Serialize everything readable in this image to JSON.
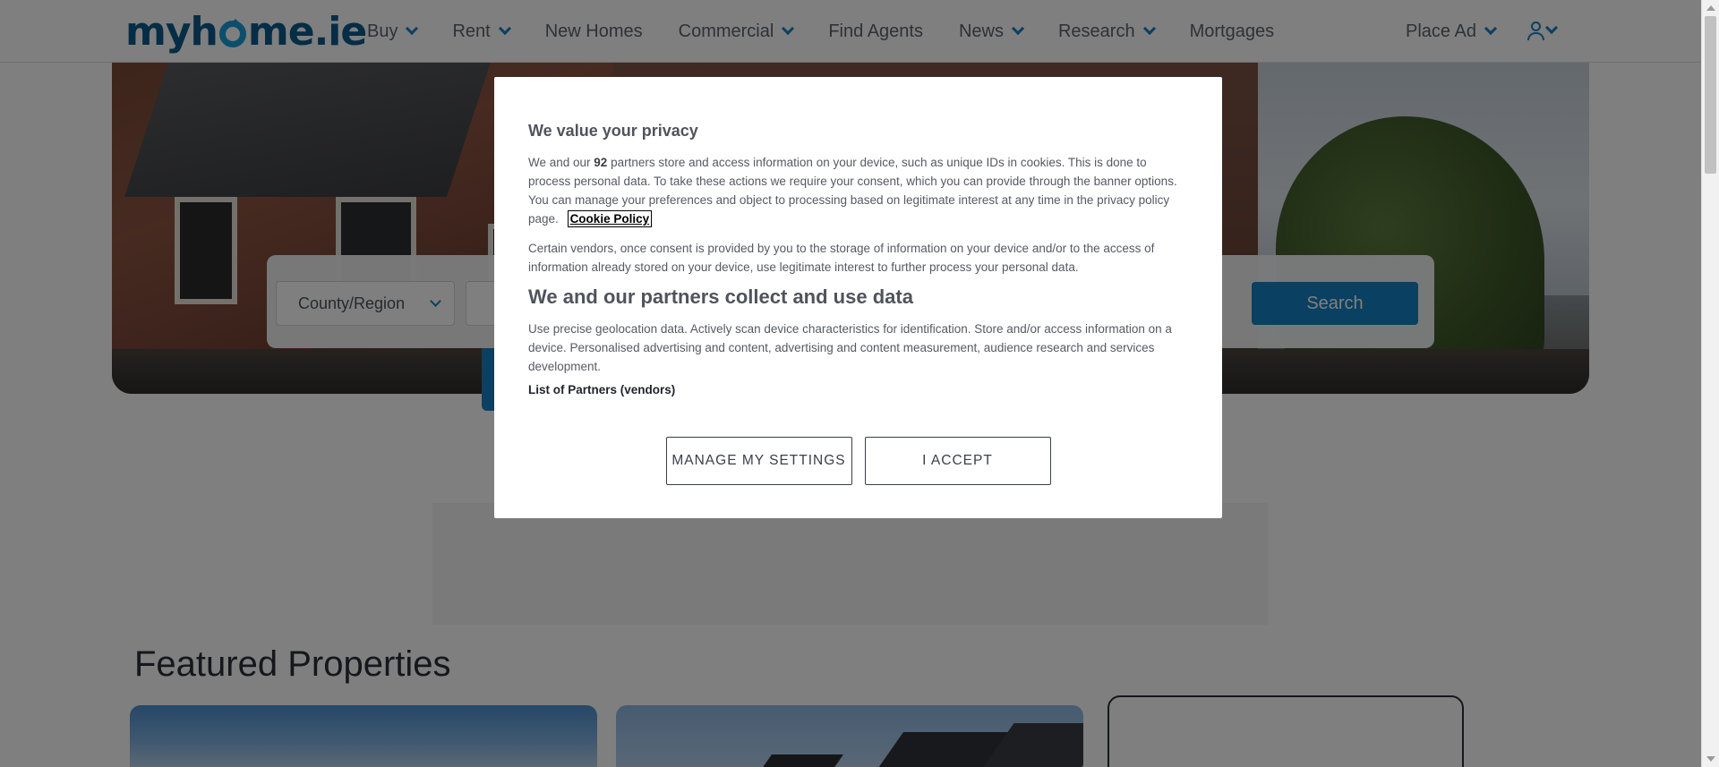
{
  "header": {
    "logo": {
      "part_a": "myh",
      "part_b": "me",
      "part_c": ".ie"
    },
    "nav": [
      {
        "label": "Buy",
        "has_dropdown": true
      },
      {
        "label": "Rent",
        "has_dropdown": true
      },
      {
        "label": "New Homes",
        "has_dropdown": false
      },
      {
        "label": "Commercial",
        "has_dropdown": true
      },
      {
        "label": "Find Agents",
        "has_dropdown": false
      },
      {
        "label": "News",
        "has_dropdown": true
      },
      {
        "label": "Research",
        "has_dropdown": true
      },
      {
        "label": "Mortgages",
        "has_dropdown": false
      }
    ],
    "place_ad": "Place Ad",
    "account_icon": "user-icon"
  },
  "search": {
    "county_placeholder": "County/Region",
    "search_label": "Search"
  },
  "featured": {
    "title": "Featured Properties"
  },
  "privacy_modal": {
    "title": "We value your privacy",
    "p1_before": "We and our ",
    "partner_count": "92",
    "p1_after": " partners store and access information on your device, such as unique IDs in cookies. This is done to process personal data. To take these actions we require your consent, which you can provide through the banner options. You can manage your preferences and object to processing based on legitimate interest at any time in the privacy policy page.",
    "cookie_policy_link": "Cookie Policy",
    "p2": "Certain vendors, once consent is provided by you to the storage of information on your device and/or to the access of information already stored on your device, use legitimate interest to further process your personal data.",
    "subtitle": "We and our partners collect and use data",
    "p3": "Use precise geolocation data. Actively scan device characteristics for identification. Store and/or access information on a device. Personalised advertising and content, advertising and content measurement, audience research and services development.",
    "vendors_link": "List of Partners (vendors)",
    "manage_button": "MANAGE MY SETTINGS",
    "accept_button": "I ACCEPT"
  },
  "colors": {
    "brand_dark": "#0b5a8a",
    "brand_accent": "#1a7fc1",
    "search_button": "#1580c4",
    "overlay": "rgba(0,0,0,0.5)"
  }
}
